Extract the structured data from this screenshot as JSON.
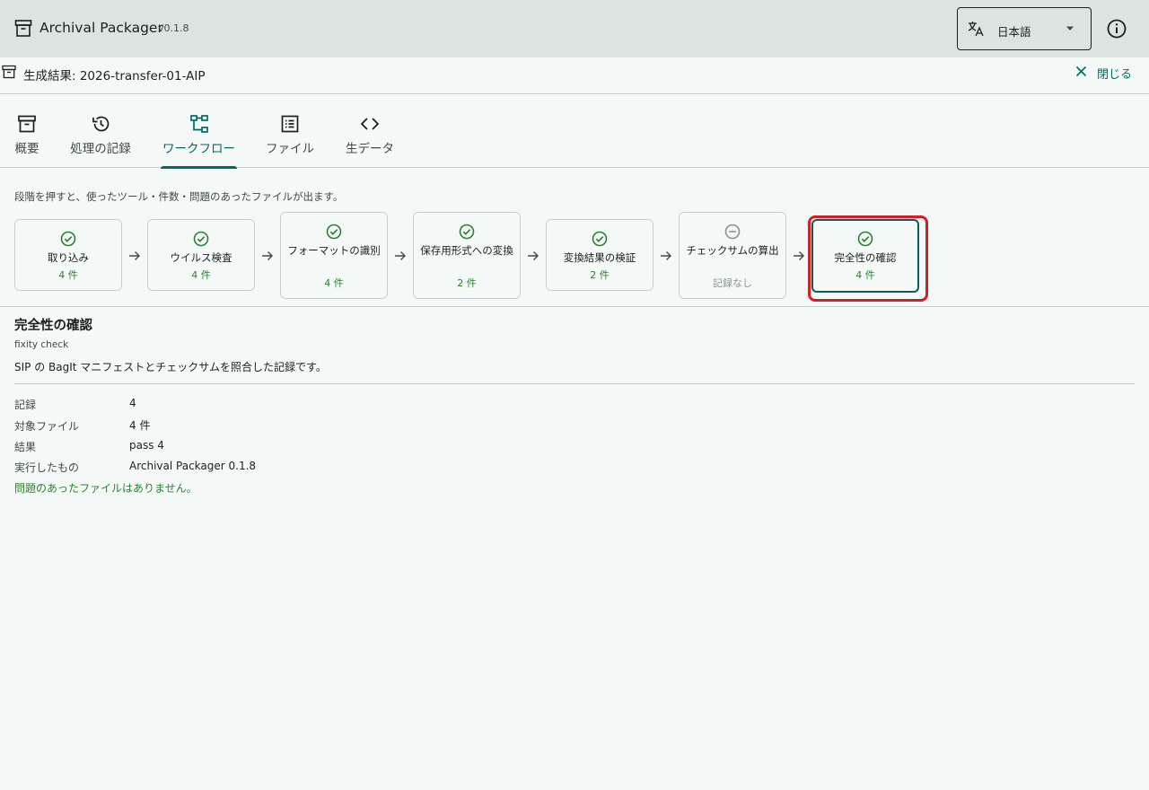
{
  "app": {
    "title": "Archival Packager",
    "version": "v0.1.8"
  },
  "language": {
    "value": "日本語"
  },
  "result": {
    "title": "生成結果: 2026-transfer-01-AIP",
    "close_label": "閉じる"
  },
  "tabs": [
    {
      "label": "概要",
      "icon": "archive-icon"
    },
    {
      "label": "処理の記録",
      "icon": "history-icon"
    },
    {
      "label": "ワークフロー",
      "icon": "workflow-icon",
      "active": true
    },
    {
      "label": "ファイル",
      "icon": "list-icon"
    },
    {
      "label": "生データ",
      "icon": "code-icon"
    }
  ],
  "workflow": {
    "hint": "段階を押すと、使ったツール・件数・問題のあったファイルが出ます。",
    "steps": [
      {
        "name": "取り込み",
        "count": "4 件",
        "status": "ok"
      },
      {
        "name": "ウイルス検査",
        "count": "4 件",
        "status": "ok"
      },
      {
        "name": "フォーマットの識別",
        "count": "4 件",
        "status": "ok"
      },
      {
        "name": "保存用形式への変換",
        "count": "2 件",
        "status": "ok"
      },
      {
        "name": "変換結果の検証",
        "count": "2 件",
        "status": "ok"
      },
      {
        "name": "チェックサムの算出",
        "count": "記録なし",
        "status": "none"
      },
      {
        "name": "完全性の確認",
        "count": "4 件",
        "status": "ok",
        "selected": true
      }
    ]
  },
  "detail": {
    "title": "完全性の確認",
    "subtitle": "fixity check",
    "description": "SIP の BagIt マニフェストとチェックサムを照合した記録です。",
    "rows": [
      {
        "key": "記録",
        "value": "4"
      },
      {
        "key": "対象ファイル",
        "value": "4 件"
      },
      {
        "key": "結果",
        "value": "pass 4"
      },
      {
        "key": "実行したもの",
        "value": "Archival Packager 0.1.8"
      }
    ],
    "ok_message": "問題のあったファイルはありません。"
  },
  "colors": {
    "accent": "#006a60",
    "success": "#2e7d32",
    "highlight": "#d32027",
    "appbar": "#dde3e1"
  }
}
